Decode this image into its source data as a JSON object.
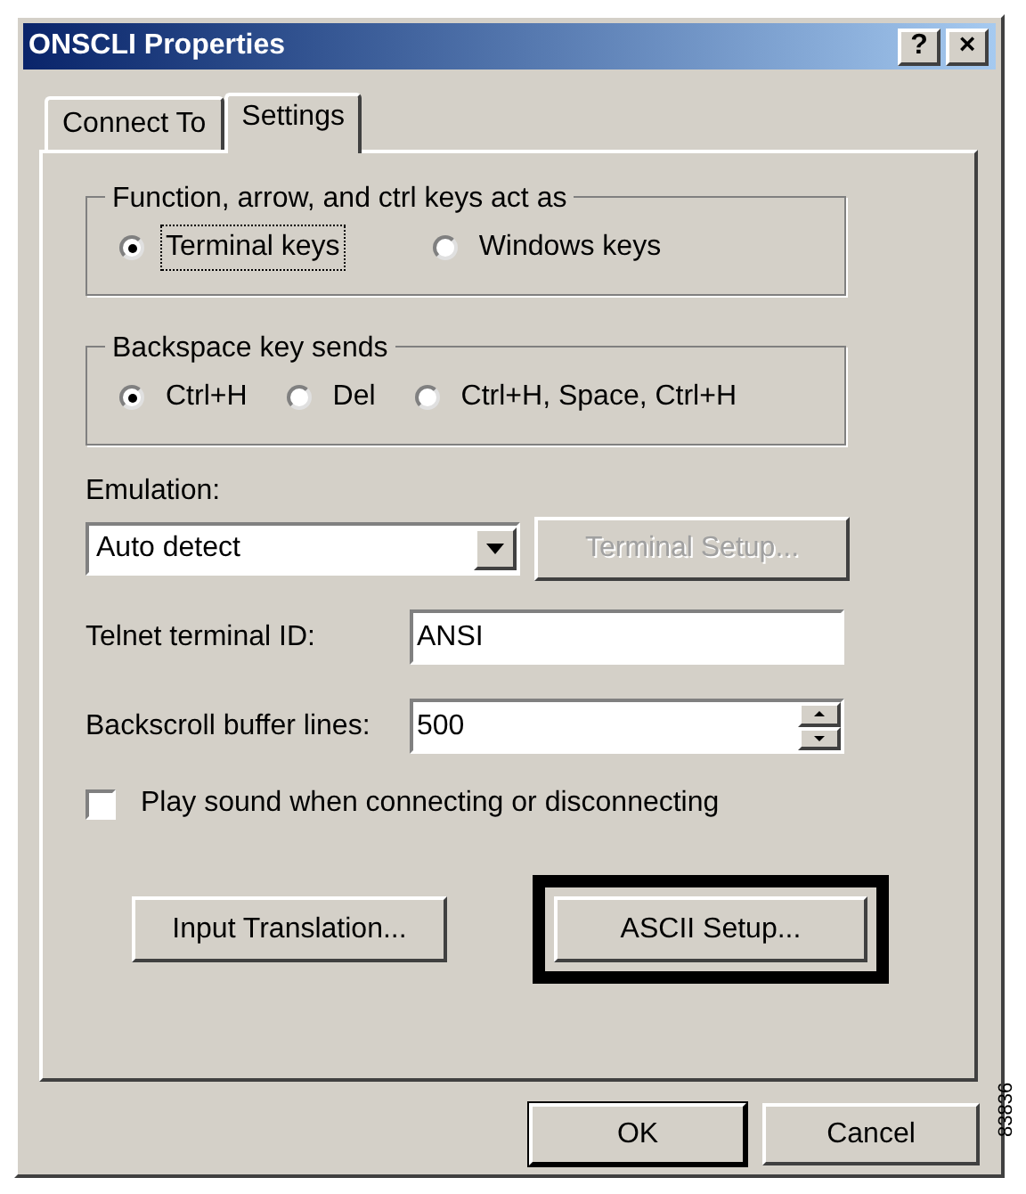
{
  "window": {
    "title": "ONSCLI Properties",
    "title_buttons": [
      "?",
      "×"
    ]
  },
  "tabs": [
    {
      "label": "Connect To",
      "selected": false
    },
    {
      "label": "Settings",
      "selected": true
    }
  ],
  "key_group": {
    "title": "Function, arrow, and ctrl keys act as",
    "options": [
      {
        "label": "Terminal keys",
        "selected": true,
        "focused": true
      },
      {
        "label": "Windows keys",
        "selected": false,
        "focused": false
      }
    ]
  },
  "backspace_group": {
    "title": "Backspace key sends",
    "options": [
      {
        "label": "Ctrl+H",
        "selected": true,
        "focused": false
      },
      {
        "label": "Del",
        "selected": false,
        "focused": false
      },
      {
        "label": "Ctrl+H, Space, Ctrl+H",
        "selected": false,
        "focused": false
      }
    ]
  },
  "emulation": {
    "label": "Emulation:",
    "value": "Auto detect"
  },
  "terminal_setup_button": {
    "label": "Terminal Setup...",
    "disabled": true
  },
  "telnet_id": {
    "label": "Telnet terminal ID:",
    "value": "ANSI"
  },
  "backscroll": {
    "label": "Backscroll buffer lines:",
    "value": "500"
  },
  "play_sound": {
    "label": "Play sound when connecting or disconnecting",
    "checked": false
  },
  "input_translation_button": {
    "label": "Input Translation...",
    "highlighted": false
  },
  "ascii_setup_button": {
    "label": "ASCII Setup...",
    "highlighted": true
  },
  "footer_buttons": [
    {
      "label": "OK",
      "default": true
    },
    {
      "label": "Cancel",
      "default": false
    }
  ],
  "figure_number": "83836"
}
